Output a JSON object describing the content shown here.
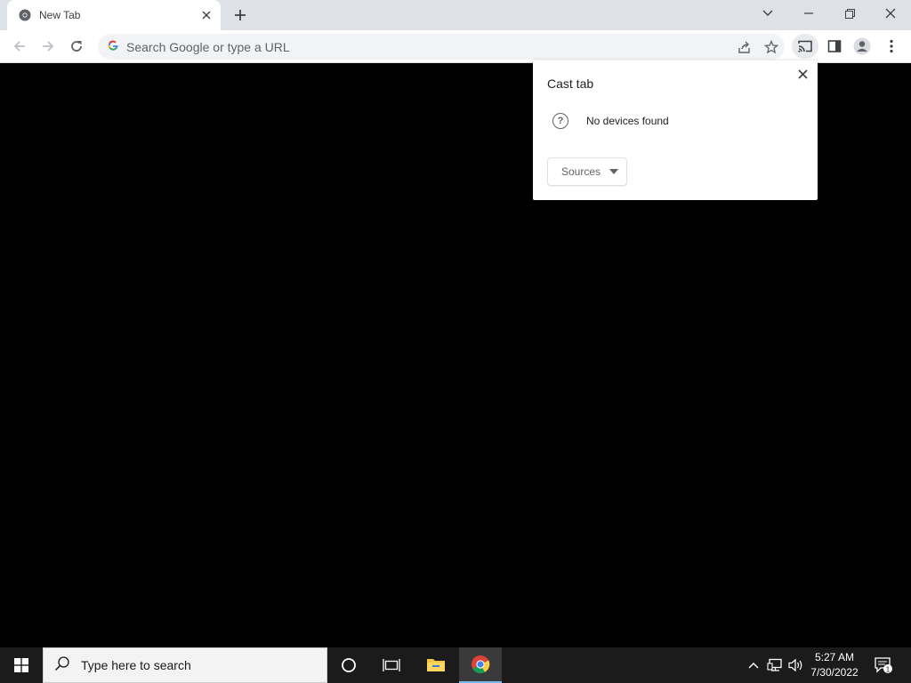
{
  "browser": {
    "tab": {
      "title": "New Tab"
    },
    "omnibox": {
      "placeholder": "Search Google or type a URL"
    }
  },
  "cast_popup": {
    "title": "Cast tab",
    "status": "No devices found",
    "sources_label": "Sources"
  },
  "taskbar": {
    "search_placeholder": "Type here to search",
    "time": "5:27 AM",
    "date": "7/30/2022",
    "notification_count": "1"
  },
  "colors": {
    "tabstrip": "#dee1e6",
    "toolbar": "#ffffff",
    "content": "#000000",
    "taskbar": "#1b1b1b",
    "active_indicator": "#76b9ed"
  }
}
